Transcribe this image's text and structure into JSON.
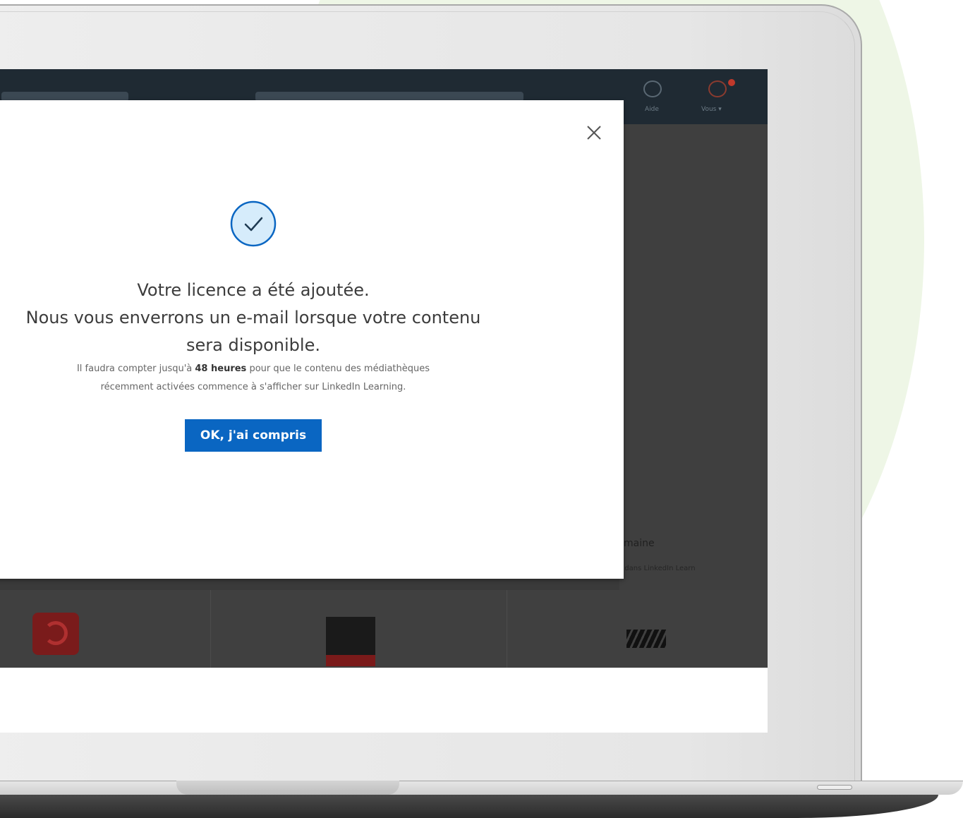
{
  "modal": {
    "title_line1": "Votre licence a été ajoutée.",
    "title_line2": "Nous vous enverrons un e-mail lorsque votre contenu",
    "title_line3": "sera disponible.",
    "note_before_bold": "Il faudra compter jusqu'à ",
    "note_bold": "48 heures",
    "note_after_bold_line1": " pour que le contenu des médiathèques",
    "note_line2": "récemment activées commence à s'afficher sur LinkedIn Learning.",
    "confirm_label": "OK, j'ai compris",
    "close_icon": "close-icon",
    "success_icon": "check-circle-icon"
  },
  "background_panel": {
    "text_fragment": "maine",
    "sub_fragment": "r dans LinkedIn Learn"
  },
  "topbar": {
    "nav_icon_labels": [
      "Aide",
      "Vous ▾"
    ]
  },
  "colors": {
    "primary_button": "#0a66c2",
    "success_circle_fill": "#d6ecfb",
    "success_circle_stroke": "#0a66c2",
    "topbar": "#1f2a33",
    "backdrop": "#3a3a3a",
    "accent_background": "#eef6e6"
  }
}
